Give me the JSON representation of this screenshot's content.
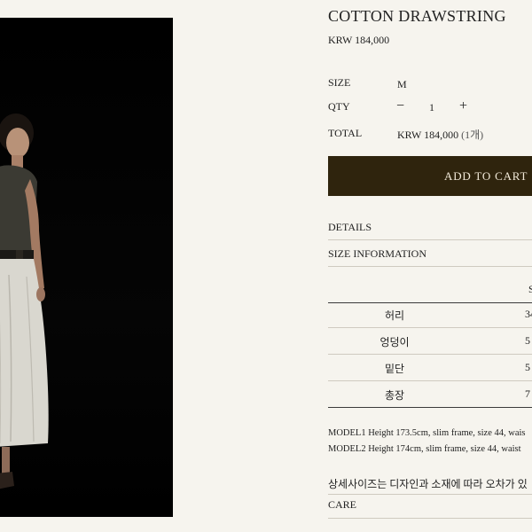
{
  "product": {
    "title": "COTTON DRAWSTRING",
    "price": "KRW 184,000"
  },
  "options": {
    "size_label": "SIZE",
    "size_value": "M",
    "qty_label": "QTY",
    "qty_minus": "−",
    "qty_value": "1",
    "qty_plus": "+",
    "total_label": "TOTAL",
    "total_value": "KRW 184,000",
    "total_count": "(1개)"
  },
  "cart": {
    "add_label": "ADD TO CART"
  },
  "sections": {
    "details": "DETAILS",
    "size_info": "SIZE INFORMATION",
    "care": "CARE"
  },
  "size_table": {
    "header": "S",
    "rows": [
      {
        "label": "허리",
        "value": "34"
      },
      {
        "label": "엉덩이",
        "value": "5"
      },
      {
        "label": "밑단",
        "value": "5"
      },
      {
        "label": "총장",
        "value": "7"
      }
    ]
  },
  "models": [
    "MODEL1 Height 173.5cm, slim frame, size 44, wais",
    "MODEL2 Height 174cm, slim frame, size 44, waist"
  ],
  "note": "상세사이즈는 디자인과 소재에 따라 오차가 있",
  "colors": {
    "background": "#f6f4ee",
    "cart_button": "#2f240d",
    "cart_text": "#f2ead9"
  }
}
